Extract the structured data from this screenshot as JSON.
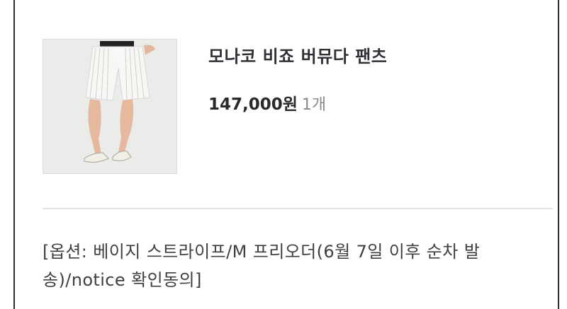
{
  "product": {
    "name": "모나코 비죠 버뮤다 팬츠",
    "price": "147,000원",
    "quantity": "1개",
    "image_icon": "product-photo-white-striped-shorts"
  },
  "option": {
    "text": "[옵션: 베이지 스트라이프/M 프리오더(6월 7일 이후 순차 발송)/notice 확인동의]"
  },
  "colors": {
    "border": "#2e2e2e",
    "divider": "#e4e4e4",
    "title": "#2f3136",
    "quantity": "#8a8a8a"
  }
}
